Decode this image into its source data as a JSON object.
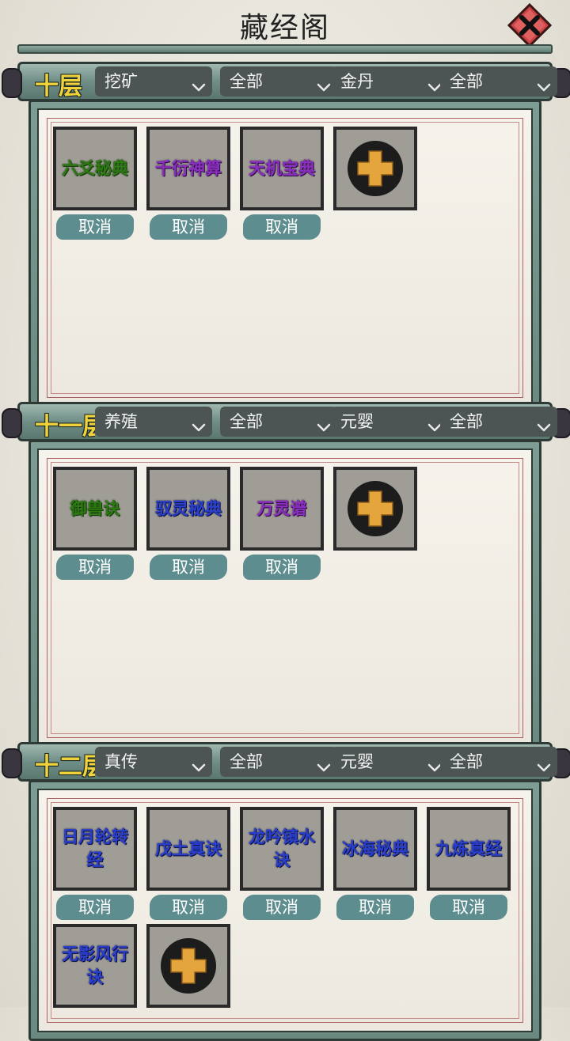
{
  "title": "藏经阁",
  "colors": {
    "accent_teal": "#5d8d8e",
    "floor_label": "#f2d23a",
    "quality_green": "#2d7a12",
    "quality_purple": "#8a2fc0",
    "quality_blue": "#2a3fcc"
  },
  "floors": [
    {
      "label": "十层",
      "filters": [
        "挖矿",
        "全部",
        "金丹",
        "全部"
      ],
      "books": [
        {
          "name": "六爻秘典",
          "quality": "green",
          "cancel": "取消"
        },
        {
          "name": "千衍神算",
          "quality": "purple",
          "cancel": "取消"
        },
        {
          "name": "天机宝典",
          "quality": "purple",
          "cancel": "取消"
        }
      ]
    },
    {
      "label": "十一层",
      "filters": [
        "养殖",
        "全部",
        "元婴",
        "全部"
      ],
      "books": [
        {
          "name": "御兽诀",
          "quality": "green",
          "cancel": "取消"
        },
        {
          "name": "驭灵秘典",
          "quality": "blue",
          "cancel": "取消"
        },
        {
          "name": "万灵谱",
          "quality": "purple",
          "cancel": "取消"
        }
      ]
    },
    {
      "label": "十二层",
      "filters": [
        "真传",
        "全部",
        "元婴",
        "全部"
      ],
      "books": [
        {
          "name": "日月轮转经",
          "quality": "blue",
          "cancel": "取消"
        },
        {
          "name": "戊土真诀",
          "quality": "blue",
          "cancel": "取消"
        },
        {
          "name": "龙吟镇水诀",
          "quality": "blue",
          "cancel": "取消"
        },
        {
          "name": "冰海秘典",
          "quality": "blue",
          "cancel": "取消"
        },
        {
          "name": "九炼真经",
          "quality": "blue",
          "cancel": "取消"
        },
        {
          "name": "无影风行诀",
          "quality": "blue",
          "cancel": null
        }
      ]
    }
  ]
}
